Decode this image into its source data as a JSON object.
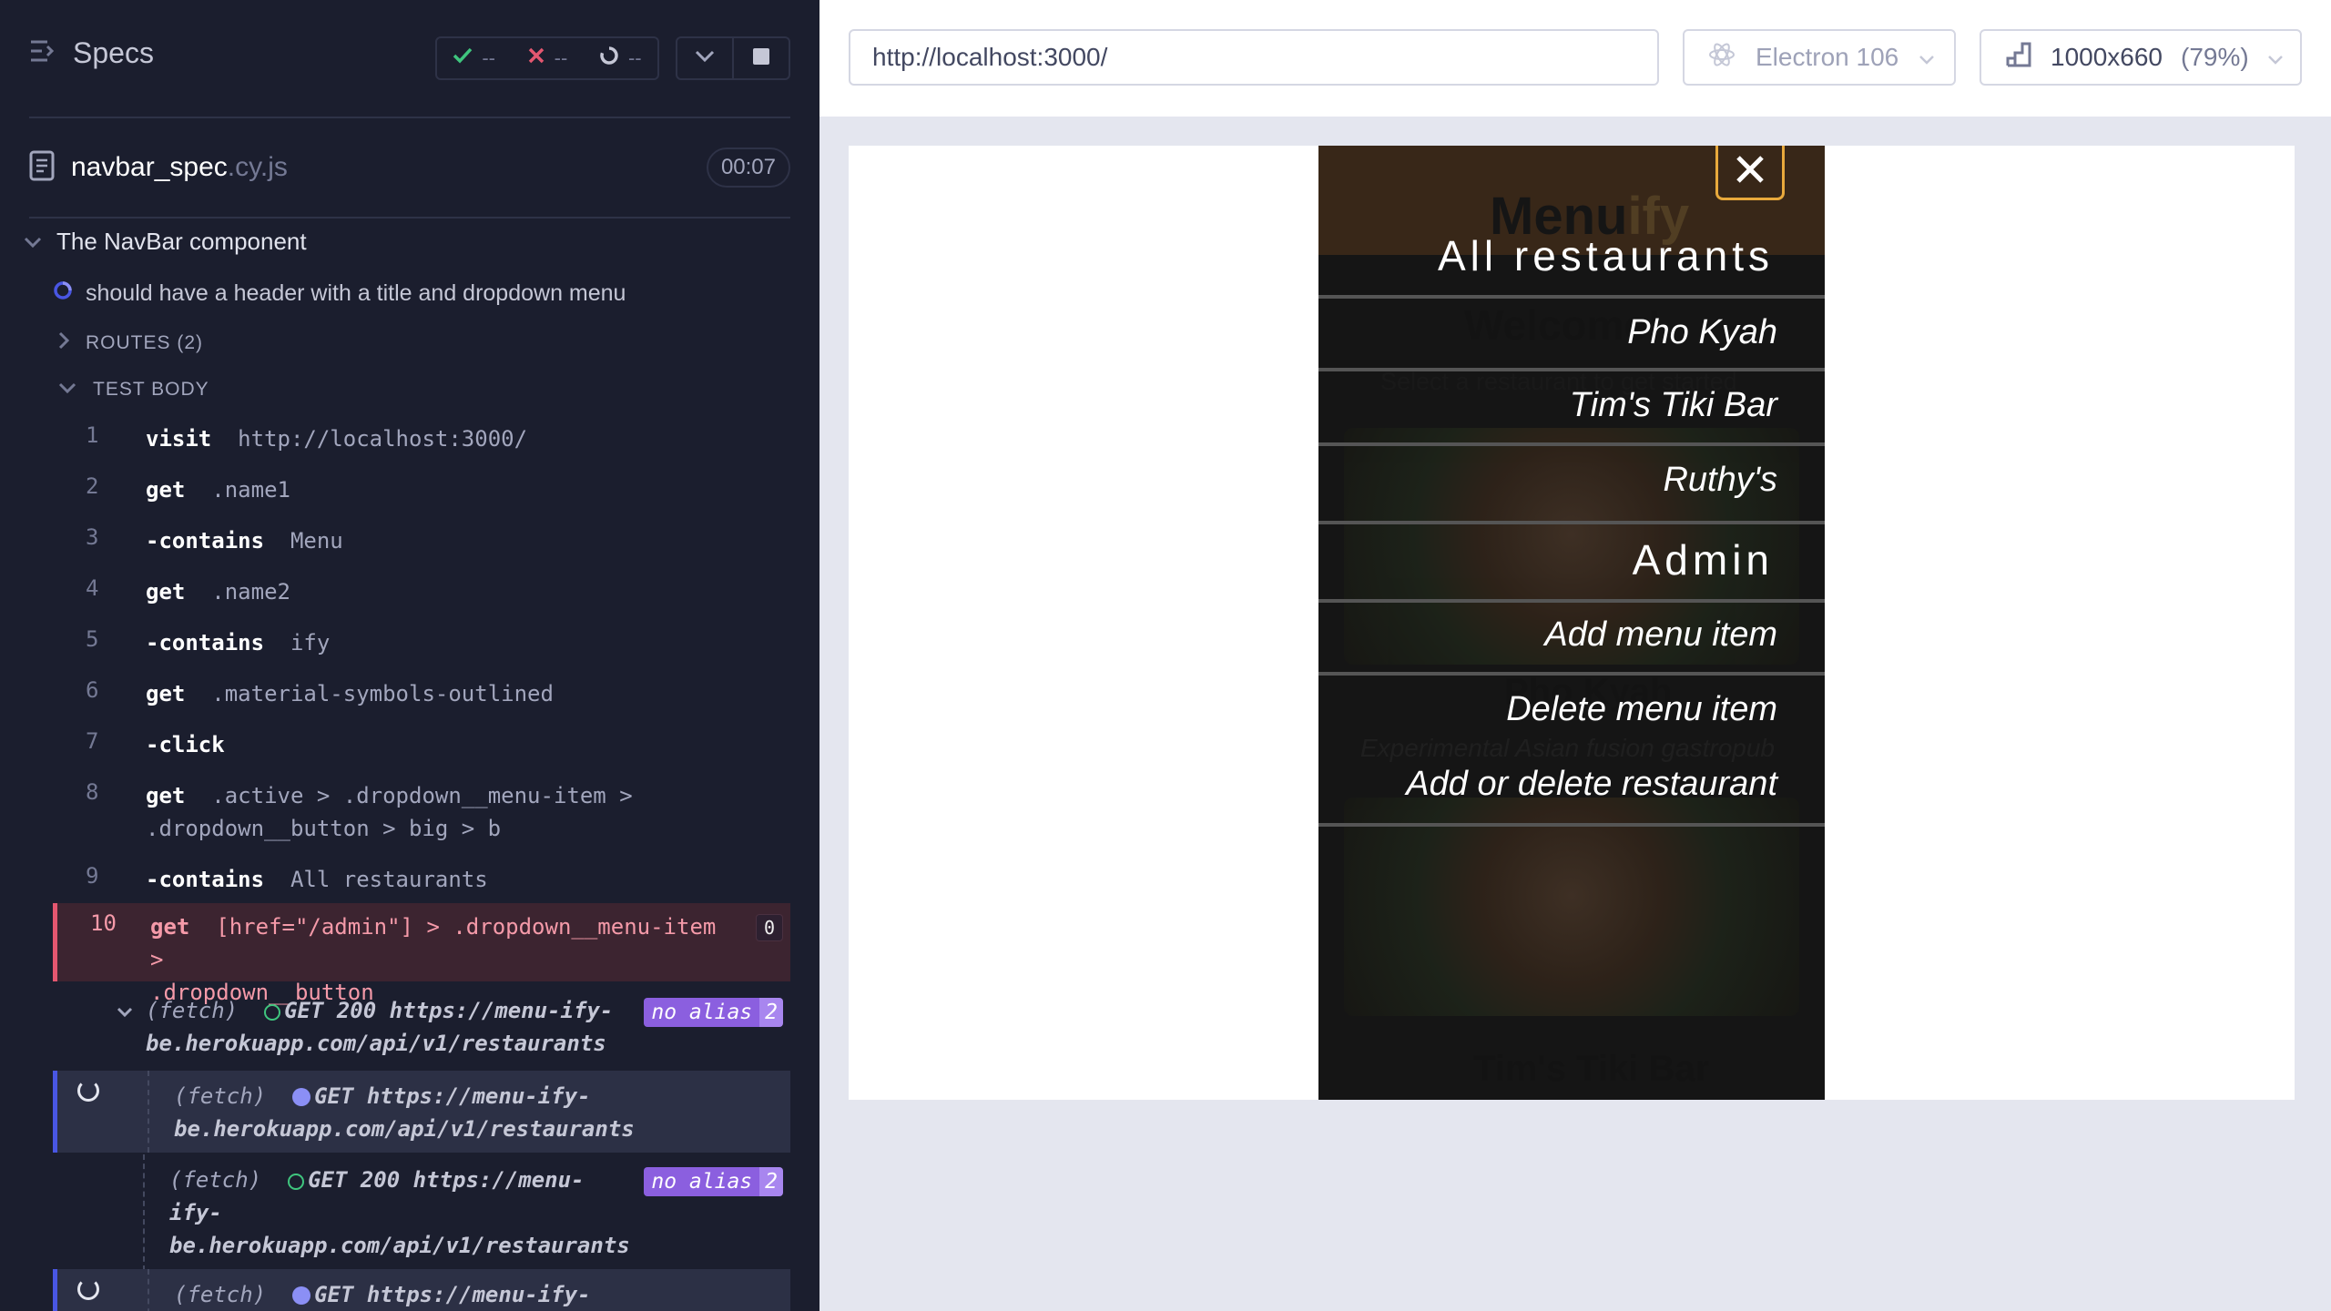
{
  "reporter": {
    "title": "Specs",
    "stats": {
      "passed": "--",
      "failed": "--",
      "pending": "--"
    },
    "spec_file": {
      "name": "navbar_spec",
      "ext": ".cy.js",
      "duration": "00:07"
    },
    "suite": "The NavBar component",
    "test": "should have a header with a title and dropdown menu",
    "routes_label": "ROUTES (2)",
    "test_body_label": "TEST BODY",
    "commands": [
      {
        "num": "1",
        "name": "visit",
        "value": "http://localhost:3000/"
      },
      {
        "num": "2",
        "name": "get",
        "value": ".name1"
      },
      {
        "num": "3",
        "name": "-contains",
        "value": "Menu"
      },
      {
        "num": "4",
        "name": "get",
        "value": ".name2"
      },
      {
        "num": "5",
        "name": "-contains",
        "value": "ify"
      },
      {
        "num": "6",
        "name": "get",
        "value": ".material-symbols-outlined"
      },
      {
        "num": "7",
        "name": "-click",
        "value": ""
      },
      {
        "num": "8",
        "name": "get",
        "value": ".active > .dropdown__menu-item >",
        "value2": ".dropdown__button > big > b"
      },
      {
        "num": "9",
        "name": "-contains",
        "value": "All restaurants"
      },
      {
        "num": "10",
        "name": "get",
        "value": "[href=\"/admin\"] > .dropdown__menu-item >",
        "value2": ".dropdown__button",
        "badge": "0"
      }
    ],
    "fetches": [
      {
        "label": "(fetch)",
        "method": "GET 200",
        "url1": "https://menu-ify-",
        "url2": "be.herokuapp.com/api/v1/restaurants",
        "alias": "no alias",
        "count": "2"
      },
      {
        "label": "(fetch)",
        "method": "GET",
        "url1": "https://menu-ify-",
        "url2": "be.herokuapp.com/api/v1/restaurants"
      },
      {
        "label": "(fetch)",
        "method": "GET 200",
        "url1": "https://menu-",
        "url2": "ify-",
        "url3": "be.herokuapp.com/api/v1/restaurants",
        "alias": "no alias",
        "count": "2"
      },
      {
        "label": "(fetch)",
        "method": "GET",
        "url1": "https://menu-ify-"
      }
    ]
  },
  "aut": {
    "url": "http://localhost:3000/",
    "browser": "Electron 106",
    "viewport": "1000x660",
    "zoom": "(79%)"
  },
  "app_bg": {
    "brand_a": "Menu",
    "brand_b": "ify",
    "welcome": "Welcome!",
    "select": "Select a restaurant to get started",
    "rest1": "Pho Kyah",
    "rest1_desc": "Experimental Asian fusion gastropub",
    "rest2": "Tim's Tiki Bar"
  },
  "menu": {
    "heading1": "All restaurants",
    "items1": [
      "Pho Kyah",
      "Tim's Tiki Bar",
      "Ruthy's"
    ],
    "heading2": "Admin",
    "items2": [
      "Add menu item",
      "Delete menu item",
      "Add or delete restaurant"
    ]
  },
  "colors": {
    "accent": "#e8a93c",
    "failed": "#e45770",
    "passed": "#3fc57e",
    "alias": "#8b5fdf"
  }
}
